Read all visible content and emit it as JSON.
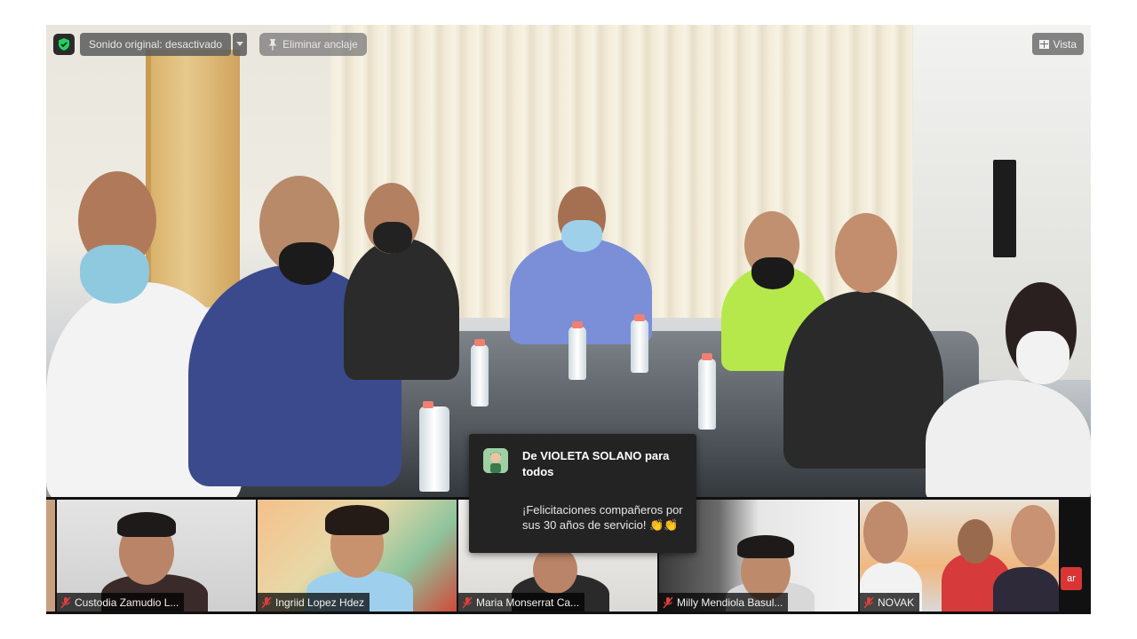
{
  "toolbar": {
    "security_icon": "shield-check-icon",
    "original_sound_label": "Sonido original: desactivado",
    "dropdown_icon": "chevron-down-icon",
    "unpin_label": "Eliminar anclaje",
    "unpin_icon": "pin-icon",
    "view_label": "Vista",
    "view_icon": "grid-icon"
  },
  "chat_notification": {
    "from": "De VIOLETA SOLANO para todos",
    "message": "¡Felicitaciones compañeros por sus 30 años de servicio! 👏👏"
  },
  "participants": [
    {
      "name": "Custodia Zamudio L...",
      "muted": true
    },
    {
      "name": "Ingriid Lopez Hdez",
      "muted": true
    },
    {
      "name": "Maria Monserrat Ca...",
      "muted": true
    },
    {
      "name": "Milly Mendiola Basul...",
      "muted": true
    },
    {
      "name": "NOVAK",
      "muted": true
    }
  ],
  "end_button_label": "ar",
  "colors": {
    "muted_mic": "#e0403c",
    "security_green": "#23d160",
    "end_red": "#d93535",
    "panel_bg": "#232323"
  }
}
